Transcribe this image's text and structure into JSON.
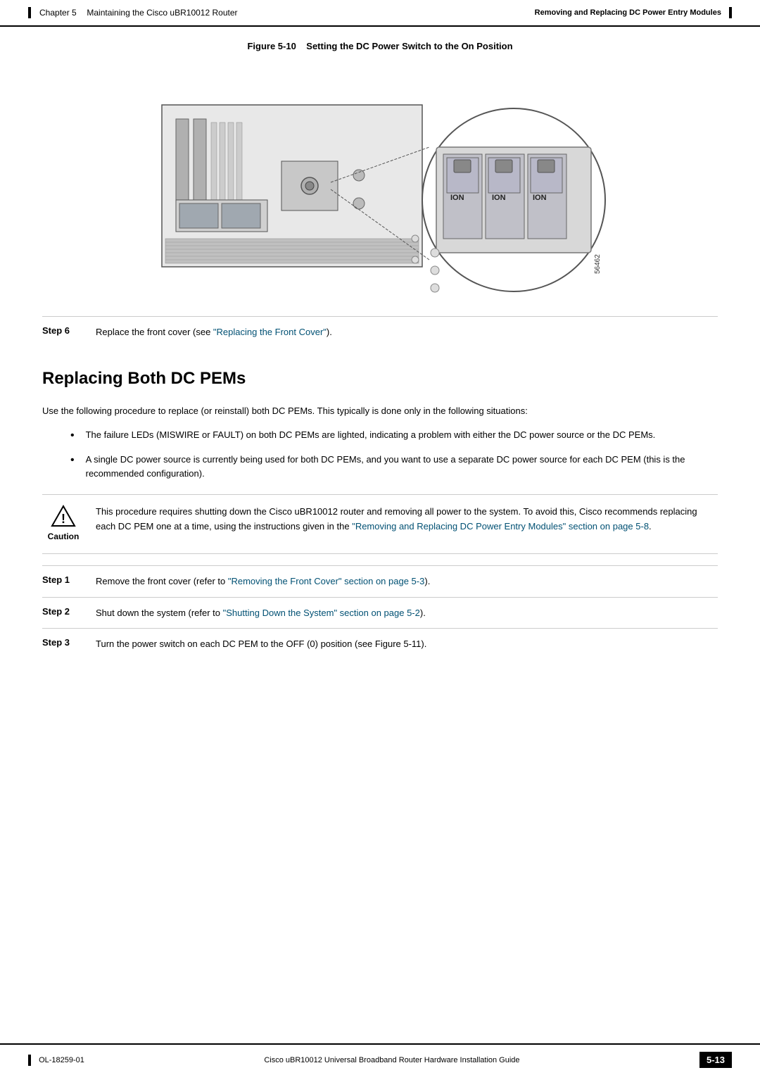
{
  "header": {
    "bar_indicator": "",
    "chapter_label": "Chapter 5",
    "chapter_title": "Maintaining the Cisco uBR10012 Router",
    "right_section": "Removing and Replacing DC Power Entry Modules"
  },
  "figure": {
    "caption_bold": "Figure 5-10",
    "caption_text": "Setting the DC Power Switch to the On Position",
    "diagram_id": "56462"
  },
  "step6": {
    "label": "Step 6",
    "text": "Replace the front cover (see ",
    "link_text": "\"Replacing the Front Cover\"",
    "text_end": ")."
  },
  "section": {
    "heading": "Replacing Both DC PEMs",
    "intro": "Use the following procedure to replace (or reinstall) both DC PEMs. This typically is done only in the following situations:"
  },
  "bullets": [
    "The failure LEDs (MISWIRE or FAULT) on both DC PEMs are lighted, indicating a problem with either the DC power source or the DC PEMs.",
    "A single DC power source is currently being used for both DC PEMs, and you want to use a separate DC power source for each DC PEM (this is the recommended configuration)."
  ],
  "caution": {
    "label": "Caution",
    "text": "This procedure requires shutting down the Cisco uBR10012 router and removing all power to the system. To avoid this, Cisco recommends replacing each DC PEM one at a time, using the instructions given in the ",
    "link_text": "\"Removing and Replacing DC Power Entry Modules\" section on page 5-8",
    "text_end": "."
  },
  "steps": [
    {
      "label": "Step 1",
      "text": "Remove the front cover (refer to ",
      "link_text": "\"Removing the Front Cover\" section on page 5-3",
      "text_end": ")."
    },
    {
      "label": "Step 2",
      "text": "Shut down the system (refer to ",
      "link_text": "\"Shutting Down the System\" section on page 5-2",
      "text_end": ")."
    },
    {
      "label": "Step 3",
      "text": "Turn the power switch on each DC PEM to the OFF (0) position (see Figure 5-11)."
    }
  ],
  "footer": {
    "left_text": "OL-18259-01",
    "center_text": "Cisco uBR10012 Universal Broadband Router Hardware Installation Guide",
    "page_num": "5-13"
  }
}
